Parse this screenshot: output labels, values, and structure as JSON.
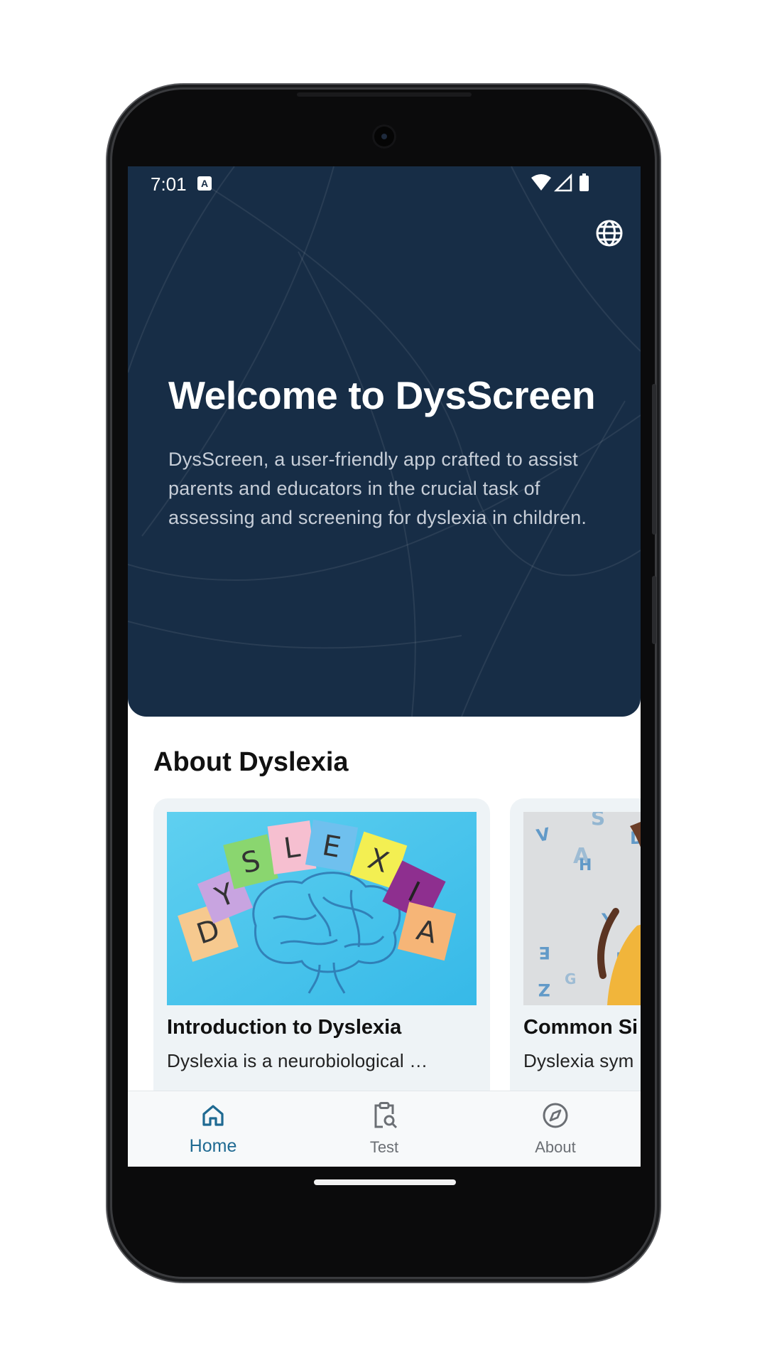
{
  "status_bar": {
    "time": "7:01",
    "notification_icon": "a-icon",
    "icons": [
      "wifi-icon",
      "signal-icon",
      "battery-icon"
    ]
  },
  "hero": {
    "language_icon": "globe-icon",
    "title": "Welcome to DysScreen",
    "description": "DysScreen, a user-friendly app crafted to assist parents and educators in the crucial task of assessing and screening for dyslexia in children.",
    "background_color": "#172d46"
  },
  "about": {
    "section_title": "About Dyslexia",
    "cards": [
      {
        "title": "Introduction to Dyslexia",
        "description": "Dyslexia is a neurobiological …",
        "image_letters": [
          "D",
          "Y",
          "S",
          "L",
          "E",
          "X",
          "I",
          "A"
        ]
      },
      {
        "title": "Common Si",
        "description": "Dyslexia sym"
      }
    ]
  },
  "bottom_nav": {
    "items": [
      {
        "label": "Home",
        "icon": "home-icon",
        "active": true
      },
      {
        "label": "Test",
        "icon": "clipboard-search-icon",
        "active": false
      },
      {
        "label": "About",
        "icon": "compass-icon",
        "active": false
      }
    ],
    "active_color": "#1f6a92"
  }
}
